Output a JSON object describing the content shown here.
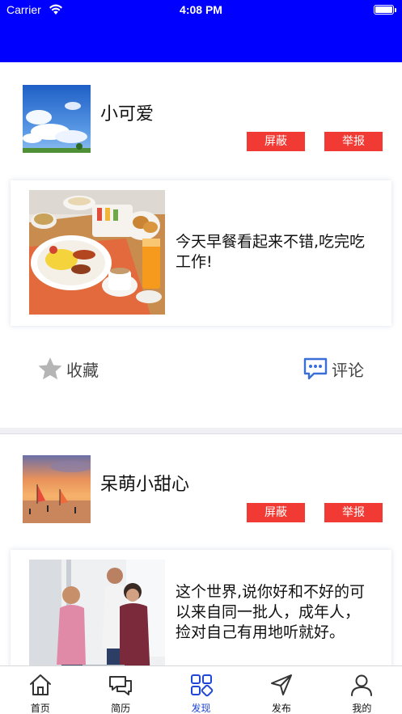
{
  "status_bar": {
    "carrier": "Carrier",
    "time": "4:08 PM"
  },
  "colors": {
    "header": "#0000ff",
    "tag_button": "#f03a33",
    "tab_active": "#1f46d6",
    "separator": "#efeff4"
  },
  "feed": [
    {
      "username": "小可爱",
      "block_label": "屏蔽",
      "report_label": "举报",
      "content": "今天早餐看起来不错,吃完吃工作!",
      "favorite_label": "收藏",
      "comment_label": "评论",
      "avatar_icon": "sky-clouds-photo",
      "image_icon": "breakfast-photo"
    },
    {
      "username": "呆萌小甜心",
      "block_label": "屏蔽",
      "report_label": "举报",
      "content": "这个世界,说你好和不好的可以来自同一批人，成年人，捡对自己有用地听就好。",
      "avatar_icon": "sunset-beach-photo",
      "image_icon": "office-people-photo"
    }
  ],
  "tabbar": {
    "items": [
      {
        "label": "首页",
        "icon": "home-icon",
        "active": false
      },
      {
        "label": "简历",
        "icon": "chat-bubbles-icon",
        "active": false
      },
      {
        "label": "发现",
        "icon": "grid-discover-icon",
        "active": true
      },
      {
        "label": "发布",
        "icon": "paper-plane-icon",
        "active": false
      },
      {
        "label": "我的",
        "icon": "user-icon",
        "active": false
      }
    ]
  }
}
